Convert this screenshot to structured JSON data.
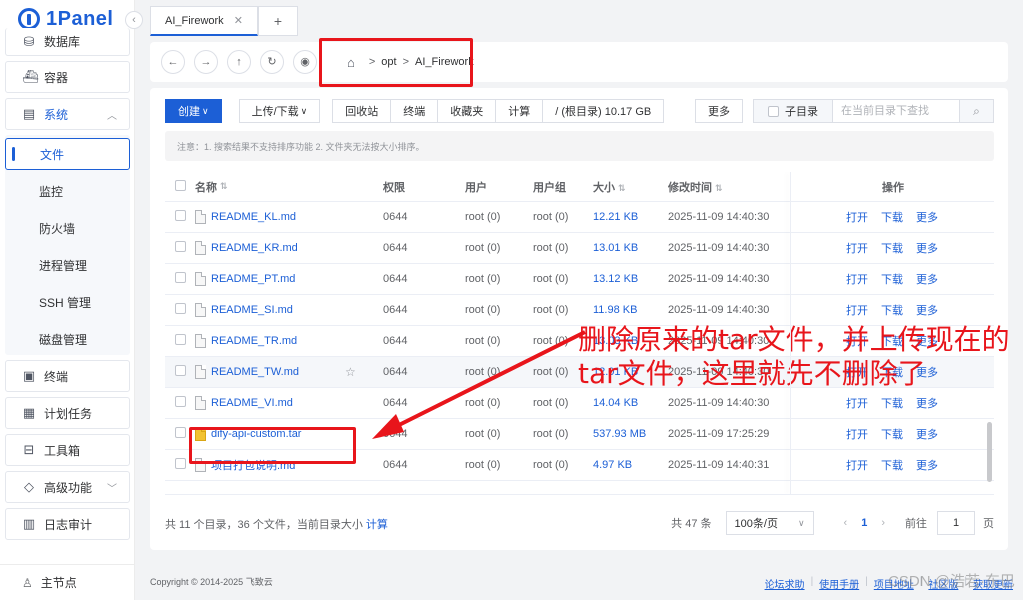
{
  "brand": {
    "logo_text": "1Panel",
    "accent": "#1c5fd6"
  },
  "sidebar": {
    "items": [
      {
        "label": "数据库",
        "icon": "database-icon"
      },
      {
        "label": "容器",
        "icon": "container-icon"
      },
      {
        "label": "系统",
        "icon": "system-icon"
      },
      {
        "label": "终端",
        "icon": "terminal-icon"
      },
      {
        "label": "计划任务",
        "icon": "schedule-icon"
      },
      {
        "label": "工具箱",
        "icon": "toolbox-icon"
      },
      {
        "label": "高级功能",
        "icon": "diamond-icon"
      },
      {
        "label": "日志审计",
        "icon": "log-icon"
      }
    ],
    "system_sub": [
      "文件",
      "监控",
      "防火墙",
      "进程管理",
      "SSH 管理",
      "磁盘管理"
    ],
    "footer": "主节点"
  },
  "tabs": [
    {
      "label": "AI_Firework"
    }
  ],
  "path": [
    "opt",
    "AI_Firework"
  ],
  "toolbar": {
    "create": "创建",
    "upload_download": "上传/下载",
    "recycle": "回收站",
    "terminal": "终端",
    "favorites": "收藏夹",
    "calculate": "计算",
    "root_info": "/ (根目录) 10.17 GB",
    "more": "更多",
    "subdir": "子目录",
    "search_placeholder": "在当前目录下查找"
  },
  "notice": "注意：1. 搜索结果不支持排序功能 2. 文件夹无法按大小排序。",
  "table": {
    "headers": {
      "name": "名称",
      "perm": "权限",
      "user": "用户",
      "group": "用户组",
      "size": "大小",
      "time": "修改时间",
      "ops": "操作"
    },
    "ops": [
      "打开",
      "下载",
      "更多"
    ],
    "rows": [
      {
        "name": "README_KL.md",
        "perm": "0644",
        "user": "root (0)",
        "group": "root (0)",
        "size": "12.21 KB",
        "time": "2025-11-09 14:40:30"
      },
      {
        "name": "README_KR.md",
        "perm": "0644",
        "user": "root (0)",
        "group": "root (0)",
        "size": "13.01 KB",
        "time": "2025-11-09 14:40:30"
      },
      {
        "name": "README_PT.md",
        "perm": "0644",
        "user": "root (0)",
        "group": "root (0)",
        "size": "13.12 KB",
        "time": "2025-11-09 14:40:30"
      },
      {
        "name": "README_SI.md",
        "perm": "0644",
        "user": "root (0)",
        "group": "root (0)",
        "size": "11.98 KB",
        "time": "2025-11-09 14:40:30"
      },
      {
        "name": "README_TR.md",
        "perm": "0644",
        "user": "root (0)",
        "group": "root (0)",
        "size": "13.03 KB",
        "time": "2025-11-09 14:40:30"
      },
      {
        "name": "README_TW.md",
        "perm": "0644",
        "user": "root (0)",
        "group": "root (0)",
        "size": "12.01 KB",
        "time": "2025-11-09 14:40:30"
      },
      {
        "name": "README_VI.md",
        "perm": "0644",
        "user": "root (0)",
        "group": "root (0)",
        "size": "14.04 KB",
        "time": "2025-11-09 14:40:30"
      },
      {
        "name": "dify-api-custom.tar",
        "perm": "0644",
        "user": "root (0)",
        "group": "root (0)",
        "size": "537.93 MB",
        "time": "2025-11-09 17:25:29"
      },
      {
        "name": "项目打包说明.md",
        "perm": "0644",
        "user": "root (0)",
        "group": "root (0)",
        "size": "4.97 KB",
        "time": "2025-11-09 14:40:31"
      }
    ]
  },
  "summary": {
    "text": "共 11 个目录，36 个文件，当前目录大小",
    "link": "计算"
  },
  "pager": {
    "total": "共 47 条",
    "page_size": "100条/页",
    "current": "1",
    "goto_label": "前往",
    "goto_value": "1",
    "page_unit": "页"
  },
  "copyright": "Copyright © 2014-2025 飞致云",
  "footer_links": [
    "论坛求助",
    "使用手册",
    "项目地址",
    "社区版",
    "获取更新"
  ],
  "watermark": "CSDN @浩若·东巴",
  "annotation": {
    "text": "删除原来的tar文件，并上传现在的tar文件，这里就先不删除了",
    "color": "#e8151b"
  }
}
